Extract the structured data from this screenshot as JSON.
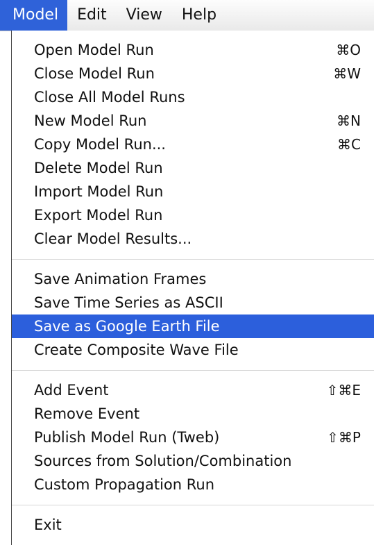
{
  "menubar": {
    "items": [
      {
        "label": "Model",
        "active": true
      },
      {
        "label": "Edit"
      },
      {
        "label": "View"
      },
      {
        "label": "Help"
      }
    ]
  },
  "menu": {
    "groups": [
      [
        {
          "label": "Open Model Run",
          "shortcut": "⌘O"
        },
        {
          "label": "Close Model Run",
          "shortcut": "⌘W"
        },
        {
          "label": "Close All Model Runs",
          "shortcut": ""
        },
        {
          "label": "New Model Run",
          "shortcut": "⌘N"
        },
        {
          "label": "Copy Model Run...",
          "shortcut": "⌘C"
        },
        {
          "label": "Delete Model Run",
          "shortcut": ""
        },
        {
          "label": "Import Model Run",
          "shortcut": ""
        },
        {
          "label": "Export Model Run",
          "shortcut": ""
        },
        {
          "label": "Clear Model Results...",
          "shortcut": ""
        }
      ],
      [
        {
          "label": "Save Animation Frames",
          "shortcut": ""
        },
        {
          "label": "Save Time Series as ASCII",
          "shortcut": ""
        },
        {
          "label": "Save as Google Earth File",
          "shortcut": "",
          "highlighted": true
        },
        {
          "label": "Create Composite Wave File",
          "shortcut": ""
        }
      ],
      [
        {
          "label": "Add Event",
          "shortcut": "⇧⌘E"
        },
        {
          "label": "Remove Event",
          "shortcut": ""
        },
        {
          "label": "Publish Model Run (Tweb)",
          "shortcut": "⇧⌘P"
        },
        {
          "label": "Sources from Solution/Combination",
          "shortcut": ""
        },
        {
          "label": "Custom Propagation Run",
          "shortcut": ""
        }
      ],
      [
        {
          "label": "Exit",
          "shortcut": ""
        }
      ]
    ]
  },
  "colors": {
    "highlight": "#2c5fdc",
    "menubar_active": "#2f62d9"
  }
}
